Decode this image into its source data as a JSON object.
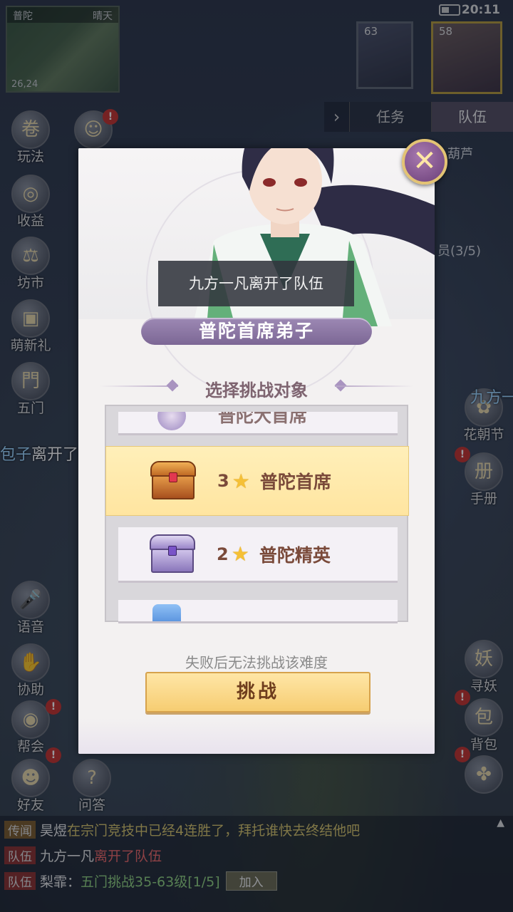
{
  "status_bar": {
    "time": "20:11"
  },
  "minimap": {
    "location": "普陀",
    "weather": "晴天",
    "coords": "26,24"
  },
  "portraits": {
    "pet_level": "63",
    "hero_level": "58"
  },
  "task_tabs": {
    "tasks": "任务",
    "team": "队伍"
  },
  "side_texts": {
    "gourd": "葫芦",
    "members": "员(3/5)"
  },
  "left_menu": [
    {
      "label": "玩法",
      "icon": "scroll-icon"
    },
    {
      "label": "收益",
      "icon": "money-bag-icon"
    },
    {
      "label": "坊市",
      "icon": "scale-icon"
    },
    {
      "label": "萌新礼",
      "icon": "gift-icon"
    },
    {
      "label": "五门",
      "icon": "gate-icon"
    },
    {
      "label": "语音",
      "icon": "microphone-icon"
    },
    {
      "label": "协助",
      "icon": "handshake-icon"
    },
    {
      "label": "帮会",
      "icon": "guild-icon",
      "badge": "!"
    },
    {
      "label": "好友",
      "icon": "friends-icon",
      "badge": "!"
    },
    {
      "label": "问答",
      "icon": "qa-icon"
    }
  ],
  "right_menu": [
    {
      "label": "花朝节",
      "icon": "flower-festival-icon"
    },
    {
      "label": "手册",
      "icon": "handbook-icon",
      "badge": "!"
    },
    {
      "label": "寻妖",
      "icon": "seek-demon-icon"
    },
    {
      "label": "背包",
      "icon": "backpack-icon",
      "badge": "!"
    }
  ],
  "floating_messages": {
    "left_name": "包子",
    "left_text": "离开了队伍",
    "right_name": "九方一"
  },
  "dialog": {
    "toast": "九方一凡离开了队伍",
    "title": "普陀首席弟子",
    "subtitle": "选择挑战对象",
    "top_partial_name": "普陀大首席",
    "options": [
      {
        "stars": "3",
        "name": "普陀首席",
        "chest": "gold",
        "selected": true
      },
      {
        "stars": "2",
        "name": "普陀精英",
        "chest": "purple",
        "selected": false
      }
    ],
    "hint": "失败后无法挑战该难度",
    "challenge_button": "挑战",
    "close_icon": "close-icon"
  },
  "chat": [
    {
      "channel": "传闻",
      "name": "昊煜",
      "message": "在宗门竞技中已经4连胜了，拜托谁快去终结他吧"
    },
    {
      "channel": "队伍",
      "name": "九方一凡",
      "message": "离开了队伍"
    },
    {
      "channel": "队伍",
      "name": "梨霏：",
      "message": "五门挑战35-63级[1/5]",
      "action": "加入"
    }
  ],
  "colors": {
    "accent_purple": "#8f7aa8",
    "button_gold": "#f6cd72",
    "selected_row": "#ffe9ac",
    "text_brown": "#7a4a3a"
  }
}
